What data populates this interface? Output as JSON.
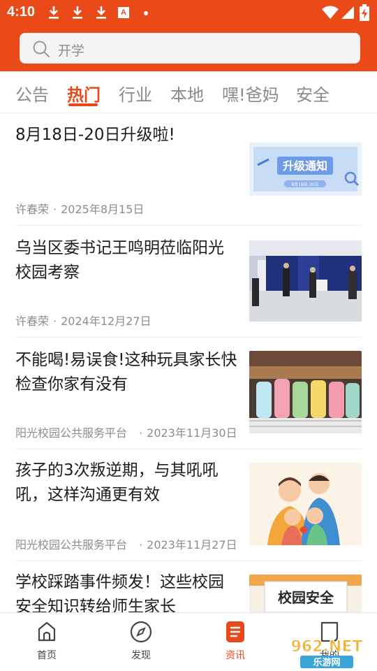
{
  "status_bar": {
    "time": "4:10",
    "badge_letter": "A"
  },
  "search": {
    "placeholder": "开学"
  },
  "tabs": [
    {
      "label": "公告"
    },
    {
      "label": "热门"
    },
    {
      "label": "行业"
    },
    {
      "label": "本地"
    },
    {
      "label": "嘿!爸妈"
    },
    {
      "label": "安全"
    }
  ],
  "active_tab": "热门",
  "news": [
    {
      "title": "8月18日-20日升级啦!",
      "author": "许春荣",
      "date": "2025年8月15日",
      "thumb_text": "升级通知",
      "thumb_subtext": "8月18日-20日"
    },
    {
      "title": "乌当区委书记王鸣明莅临阳光校园考察",
      "author": "许春荣",
      "date": "2024年12月27日"
    },
    {
      "title": "不能喝!易误食!这种玩具家长快检查你家有没有",
      "author": "阳光校园公共服务平台",
      "date": "2023年11月30日"
    },
    {
      "title": "孩子的3次叛逆期，与其吼吼吼，这样沟通更有效",
      "author": "阳光校园公共服务平台",
      "date": "2023年11月27日"
    },
    {
      "title": "学校踩踏事件频发！这些校园安全知识转给师生家长",
      "thumb_text": "校园安全"
    }
  ],
  "bottom_nav": [
    {
      "label": "首页",
      "icon": "home-icon"
    },
    {
      "label": "发现",
      "icon": "compass-icon"
    },
    {
      "label": "资讯",
      "icon": "news-icon",
      "active": true
    },
    {
      "label": "我的",
      "icon": "profile-icon"
    }
  ],
  "watermark": {
    "text": "962.NET",
    "subtext": "乐游网"
  },
  "colors": {
    "brand": "#ea4a18",
    "active_tab": "#e8491b"
  }
}
